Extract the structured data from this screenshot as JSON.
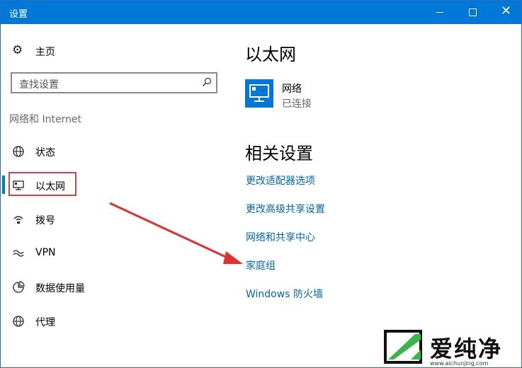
{
  "window": {
    "title": "设置"
  },
  "sidebar": {
    "home_label": "主页",
    "search_placeholder": "查找设置",
    "section_title": "网络和 Internet",
    "items": [
      {
        "label": "状态",
        "icon": "globe-icon"
      },
      {
        "label": "以太网",
        "icon": "monitor-icon",
        "selected": true
      },
      {
        "label": "拨号",
        "icon": "phone-icon"
      },
      {
        "label": "VPN",
        "icon": "vpn-icon"
      },
      {
        "label": "数据使用量",
        "icon": "data-usage-icon"
      },
      {
        "label": "代理",
        "icon": "globe-icon"
      }
    ]
  },
  "main": {
    "title": "以太网",
    "network": {
      "name": "网络",
      "status": "已连接"
    },
    "related_title": "相关设置",
    "links": [
      "更改适配器选项",
      "更改高级共享设置",
      "网络和共享中心",
      "家庭组",
      "Windows 防火墙"
    ]
  },
  "watermark": {
    "brand": "爱纯净",
    "url": "www.aichunjing.com"
  },
  "colors": {
    "accent": "#0078d7",
    "link": "#0066b4",
    "highlight": "#e03e3e"
  }
}
